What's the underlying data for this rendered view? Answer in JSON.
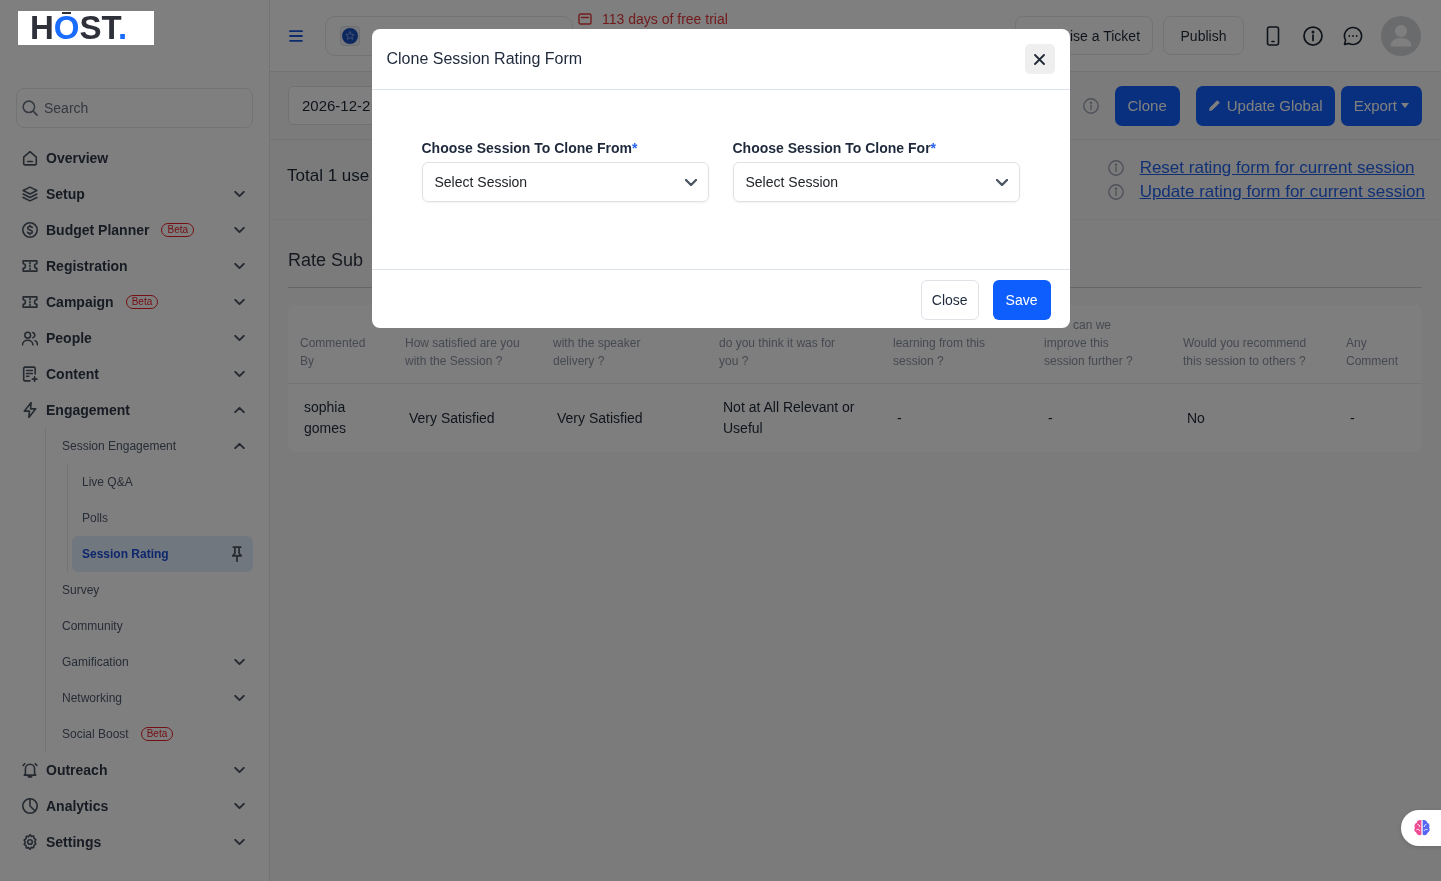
{
  "logo": {
    "text": "HOST."
  },
  "sidebar": {
    "search": {
      "placeholder": "Search"
    },
    "items": [
      {
        "label": "Overview",
        "selected": false
      },
      {
        "label": "Setup",
        "selected": false,
        "expanded": false
      },
      {
        "label": "Budget Planner",
        "badge": "Beta",
        "selected": false,
        "expanded": false
      },
      {
        "label": "Registration",
        "selected": false,
        "expanded": false
      },
      {
        "label": "Campaign",
        "badge": "Beta",
        "selected": false,
        "expanded": false
      },
      {
        "label": "People",
        "selected": false,
        "expanded": false
      },
      {
        "label": "Content",
        "selected": false,
        "expanded": false
      },
      {
        "label": "Engagement",
        "selected": false,
        "expanded": true,
        "children": [
          {
            "label": "Session Engagement",
            "selected": false,
            "expanded": true,
            "children": [
              {
                "label": "Live Q&A",
                "selected": false,
                "pinned": false
              },
              {
                "label": "Polls",
                "selected": false,
                "pinned": false
              },
              {
                "label": "Session Rating",
                "selected": true,
                "pinned": true
              }
            ]
          },
          {
            "label": "Survey",
            "selected": false
          },
          {
            "label": "Community",
            "selected": false
          },
          {
            "label": "Gamification",
            "selected": false,
            "expanded": false
          },
          {
            "label": "Networking",
            "selected": false,
            "expanded": false
          },
          {
            "label": "Social Boost",
            "badge": "Beta",
            "selected": false
          }
        ]
      },
      {
        "label": "Outreach",
        "selected": false,
        "expanded": false
      },
      {
        "label": "Analytics",
        "selected": false,
        "expanded": false
      },
      {
        "label": "Settings",
        "selected": false,
        "expanded": false
      }
    ]
  },
  "topbar": {
    "trial_notice": "113 days of free trial",
    "ticket_button": "ise a Ticket",
    "publish_button": "Publish"
  },
  "toolbar": {
    "date": "2026-12-2",
    "buttons": [
      {
        "label": "Clone",
        "kind": "plain"
      },
      {
        "label": "Update Global",
        "kind": "edit"
      },
      {
        "label": "Export",
        "kind": "menu"
      }
    ]
  },
  "summary": {
    "total": "Total 1 use",
    "links": [
      "Reset rating form for current session",
      "Update rating form for current session"
    ]
  },
  "submissions": {
    "title": "Rate Sub",
    "table": {
      "columns": [
        "Commented By",
        "How satisfied are you with the Session ?",
        "with the speaker delivery ?",
        "do you think it was for you ?",
        "learning from this session ?",
        "can we improve this session further ?",
        "Would you recommend this session to others ?",
        "Any Comment"
      ],
      "rows": [
        [
          "sophia gomes",
          "Very Satisfied",
          "Very Satisfied",
          "Not at All Relevant or Useful",
          "-",
          "-",
          "No",
          "-"
        ]
      ]
    }
  },
  "dialog": {
    "title": "Clone Session Rating Form",
    "fields": [
      {
        "label": "Choose Session To Clone From",
        "mark": "*",
        "placeholder": "Select Session"
      },
      {
        "label": "Choose Session To Clone For",
        "mark": "*",
        "placeholder": "Select Session"
      }
    ],
    "buttons": [
      {
        "label": "Close",
        "kind": "secondary"
      },
      {
        "label": "Save",
        "kind": "primary"
      }
    ]
  }
}
